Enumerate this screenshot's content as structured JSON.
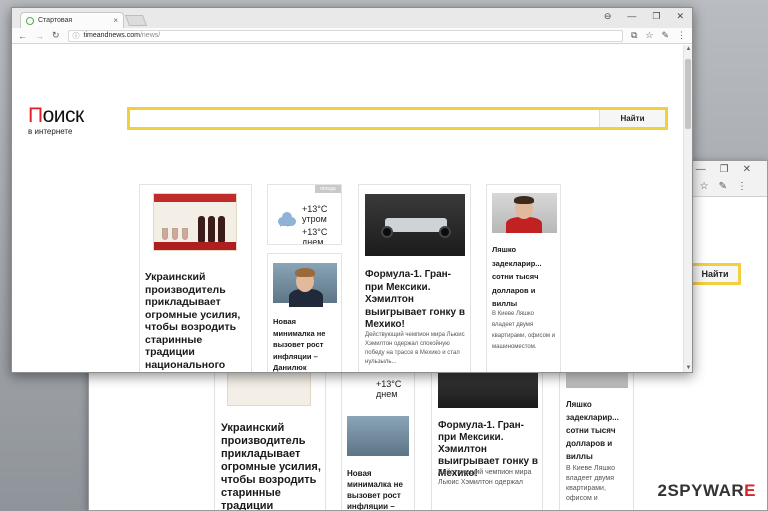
{
  "browser": {
    "tab_title": "Стартовая",
    "tab_close": "×",
    "url_host": "timeandnews.com",
    "url_path": "/news/",
    "window_controls": [
      "⊖",
      "—",
      "❐",
      "✕"
    ],
    "back_window_controls": [
      "—",
      "❐",
      "✕"
    ]
  },
  "logo": {
    "brand_first_letter": "П",
    "brand_rest": "оиск",
    "subtitle": "в интернете"
  },
  "search": {
    "placeholder": "",
    "button_label": "Найти"
  },
  "cards": {
    "wine": {
      "headline": "Украинский производитель прикладывает огромные усилия, чтобы возродить старинные традиции национального виноделия."
    },
    "weather": {
      "badge": "погода",
      "morning": "+13°C утром",
      "day": "+13°C днем"
    },
    "economy": {
      "headline": "Новая минималка не вызовет рост инфляции – Данилюк"
    },
    "formula": {
      "headline": "Формула-1. Гран-при Мексики. Хэмилтон выигрывает гонку в Мехико!",
      "text": "Действующий чемпион мира Льюис Хэмилтон одержал спокойную победу на трассе в Мехико и стал нульзыль..."
    },
    "lyashko": {
      "headline": "Ляшко задекларир... сотни тысяч долларов и виллы",
      "text": "В Киеве Ляшко владеет двумя квартирами, офисом и машиноместом."
    }
  },
  "back_window": {
    "search_button_label": "Найти",
    "weather_day": "+13°C днем",
    "wine_headline": "Украинский производитель прикладывает огромные усилия, чтобы возродить старинные традиции национального",
    "economy_headline": "Новая минималка не вызовет рост инфляции –",
    "formula_headline": "Формула-1. Гран-при Мексики. Хэмилтон выигрывает гонку в Мехико!",
    "formula_text": "Действующий чемпион мира Льюис Хэмилтон одержал",
    "lyashko_headline": "Ляшко задекларир... сотни тысяч долларов и виллы",
    "lyashko_text": "В Киеве Ляшко владеет двумя квартирами, офисом и"
  },
  "watermark": {
    "prefix": "2SPYWAR",
    "suffix": "E"
  },
  "colors": {
    "search_border": "#f2cf3f",
    "logo_red": "#e51e25",
    "watermark_red": "#d8232a"
  }
}
